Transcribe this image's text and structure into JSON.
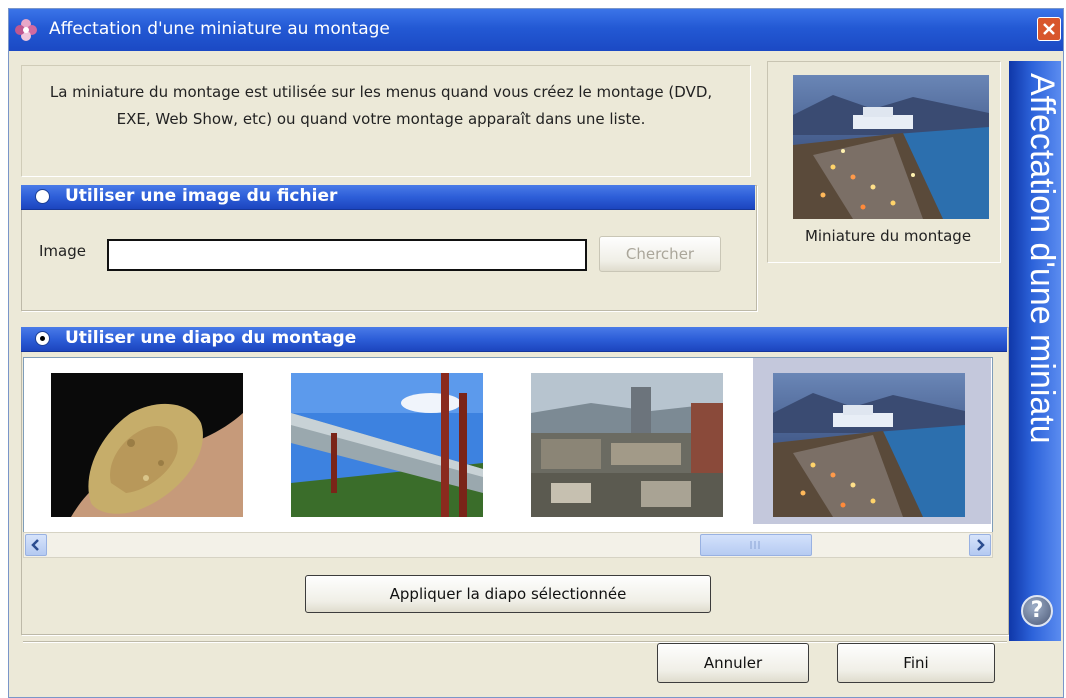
{
  "window": {
    "title": "Affectation d'une miniature au montage",
    "side_banner": "Affectation d'une miniatu"
  },
  "description": "La miniature du montage est utilisée sur les menus quand vous créez le montage (DVD, EXE, Web Show, etc) ou quand votre montage apparaît dans une liste.",
  "file_option": {
    "label": "Utiliser une image du fichier",
    "image_label": "Image",
    "image_value": "",
    "browse_button": "Chercher"
  },
  "preview": {
    "caption": "Miniature du montage"
  },
  "slide_option": {
    "label": "Utiliser une diapo du montage",
    "apply_button": "Appliquer la diapo sélectionnée"
  },
  "footer": {
    "cancel_button": "Annuler",
    "done_button": "Fini"
  },
  "icons": {
    "app": "flower-app-icon",
    "close": "close-icon",
    "help": "help-icon",
    "scroll_left": "arrow-left-icon",
    "scroll_right": "arrow-right-icon"
  },
  "colors": {
    "title_bar": "#2359d4",
    "group_header": "#2d5ed8",
    "window_bg": "#ece9d8",
    "close_button": "#d8562c"
  }
}
